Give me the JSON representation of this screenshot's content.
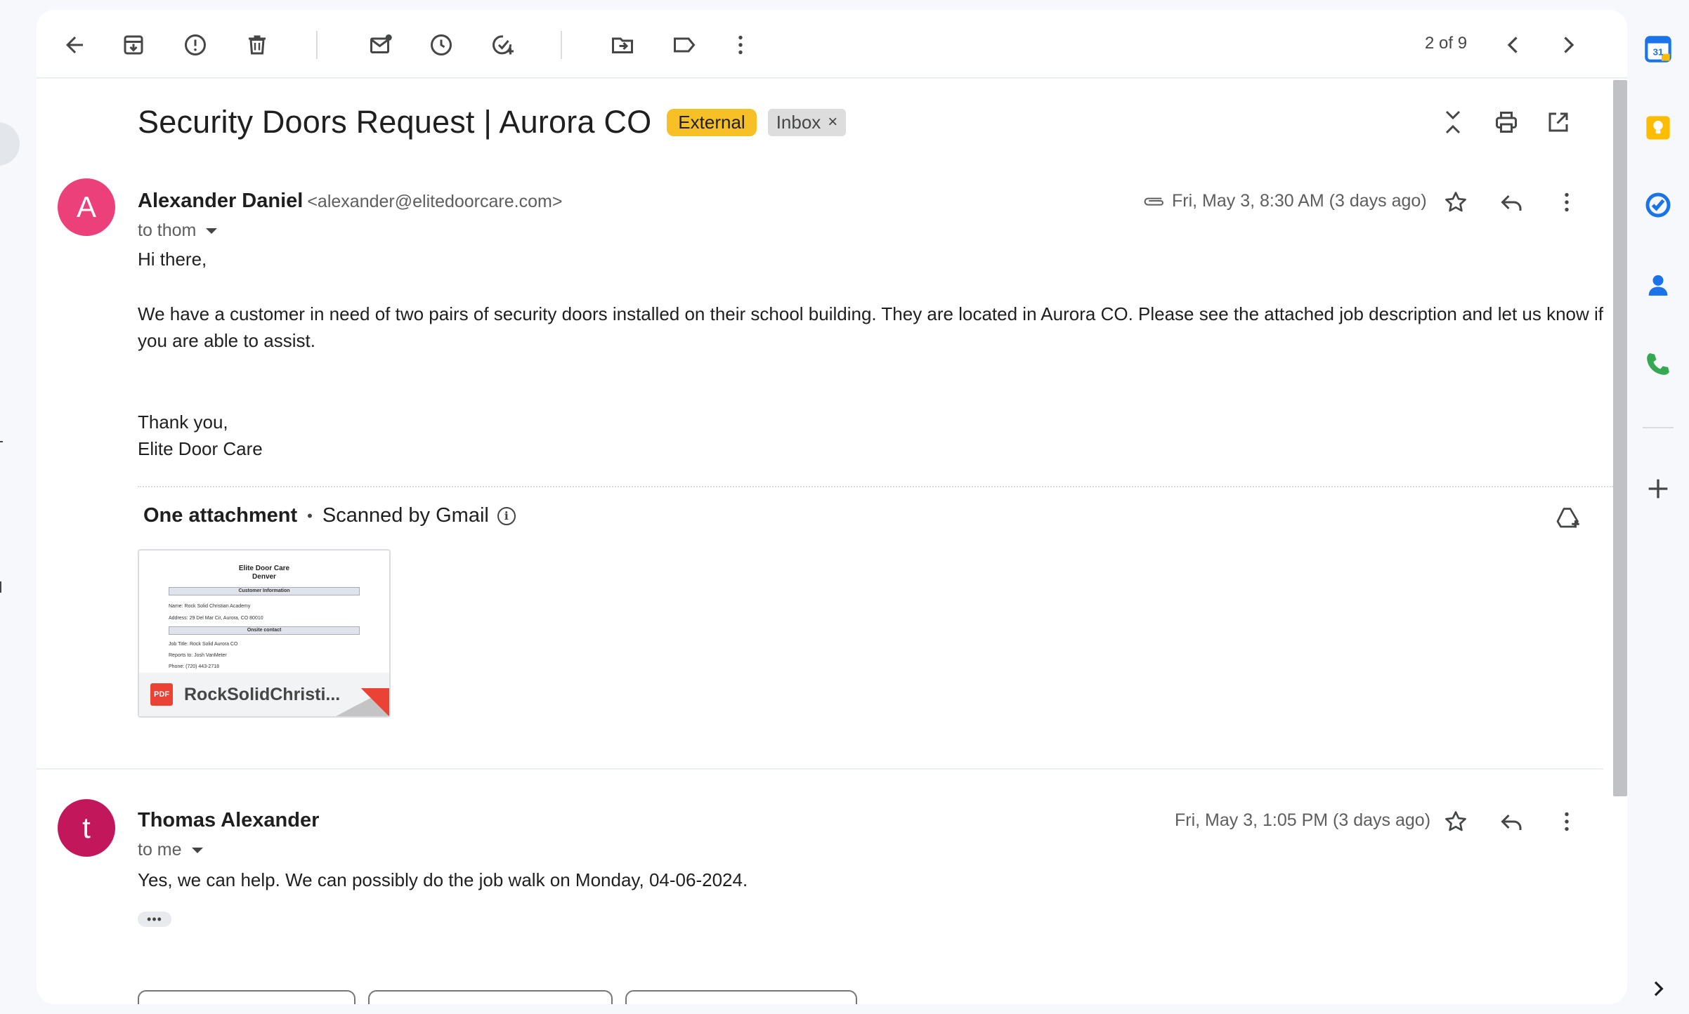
{
  "toolbar": {
    "back": "back-icon",
    "archive": "archive-icon",
    "report_spam": "report-spam-icon",
    "delete": "delete-icon",
    "mark_unread": "mark-unread-icon",
    "snooze": "snooze-icon",
    "add_task": "add-task-icon",
    "move_to": "move-to-icon",
    "labels": "label-icon",
    "more": "more-vert-icon",
    "page_count": "2 of 9"
  },
  "subject": {
    "title": "Security Doors Request | Aurora CO",
    "external_label": "External",
    "inbox_label": "Inbox",
    "inbox_remove": "×"
  },
  "messages": [
    {
      "avatar_letter": "A",
      "avatar_color": "#ec407a",
      "sender_name": "Alexander Daniel",
      "sender_email": "<alexander@elitedoorcare.com>",
      "to": "to thom",
      "date": "Fri, May 3, 8:30 AM (3 days ago)",
      "body": {
        "greeting": "Hi there,",
        "paragraph": "We have a customer in need of two pairs of security doors installed on their school building. They are located in Aurora CO. Please see the attached job description and let us know if you are able to assist.",
        "closing": "Thank you,",
        "signature": "Elite Door Care"
      },
      "attachments": {
        "title": "One attachment",
        "scanned": "Scanned by Gmail",
        "file": {
          "type_label": "PDF",
          "name": "RockSolidChristi...",
          "preview": {
            "heading1": "Elite Door Care",
            "heading2": "Denver",
            "section1": "Customer Information",
            "name_line": "Name: Rock Solid Christian Academy",
            "address_line": "Address: 29 Del Mar Cir, Aurora, CO 80010",
            "section2": "Onsite contact",
            "job_line": "Job Title: Rock Solid Aurora CO",
            "reports_line": "Reports to: Josh VanMeter",
            "phone_line": "Phone: (720) 443-2718"
          }
        }
      }
    },
    {
      "avatar_letter": "t",
      "avatar_color": "#c2185b",
      "sender_name": "Thomas Alexander",
      "to": "to me",
      "date": "Fri, May 3, 1:05 PM (3 days ago)",
      "body": "Yes, we can help. We can possibly do the job walk on Monday, 04-06-2024.",
      "trimmed": "•••"
    }
  ],
  "colors": {
    "external_badge": "#f6c026",
    "accent_blue": "#1a73e8"
  }
}
